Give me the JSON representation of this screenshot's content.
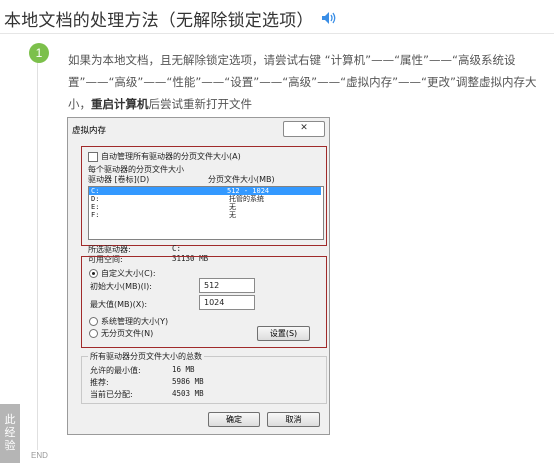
{
  "article": {
    "title": "本地文档的处理方法（无解除锁定选项）",
    "step_number": "1",
    "step_text_pre": "如果为本地文档，且无解除锁定选项，请尝试右键 “计算机”——“属性”——“高级系统设置”——“高级”——“性能”——“设置”——“高级”——“虚拟内存”——“更改”调整虚拟内存大小，",
    "step_text_bold": "重启计算机",
    "step_text_post": "后尝试重新打开文件",
    "end_label": "END",
    "side_tab": [
      "此",
      "经",
      "验"
    ]
  },
  "dialog": {
    "title": "虚拟内存",
    "close_glyph": "✕",
    "auto_manage_label": "自动管理所有驱动器的分页文件大小(A)",
    "per_drive_heading": "每个驱动器的分页文件大小",
    "col_drive": "驱动器 [卷标](D)",
    "col_paging": "分页文件大小(MB)",
    "drives": [
      {
        "drive": "C:",
        "size": "512 - 1024",
        "selected": true
      },
      {
        "drive": "D:",
        "size": "托管的系统",
        "selected": false
      },
      {
        "drive": "E:",
        "size": "无",
        "selected": false
      },
      {
        "drive": "F:",
        "size": "无",
        "selected": false
      }
    ],
    "selected_drive_label": "所选驱动器:",
    "selected_drive_value": "C:",
    "available_space_label": "可用空间:",
    "available_space_value": "31130 MB",
    "custom_size_label": "自定义大小(C):",
    "initial_size_label": "初始大小(MB)(I):",
    "initial_size_value": "512",
    "max_size_label": "最大值(MB)(X):",
    "max_size_value": "1024",
    "system_managed_label": "系统管理的大小(Y)",
    "no_paging_label": "无分页文件(N)",
    "set_button": "设置(S)",
    "totals_heading": "所有驱动器分页文件大小的总数",
    "min_allowed_label": "允许的最小值:",
    "min_allowed_value": "16 MB",
    "recommended_label": "推荐:",
    "recommended_value": "5986 MB",
    "current_label": "当前已分配:",
    "current_value": "4503 MB",
    "ok_button": "确定",
    "cancel_button": "取消"
  }
}
